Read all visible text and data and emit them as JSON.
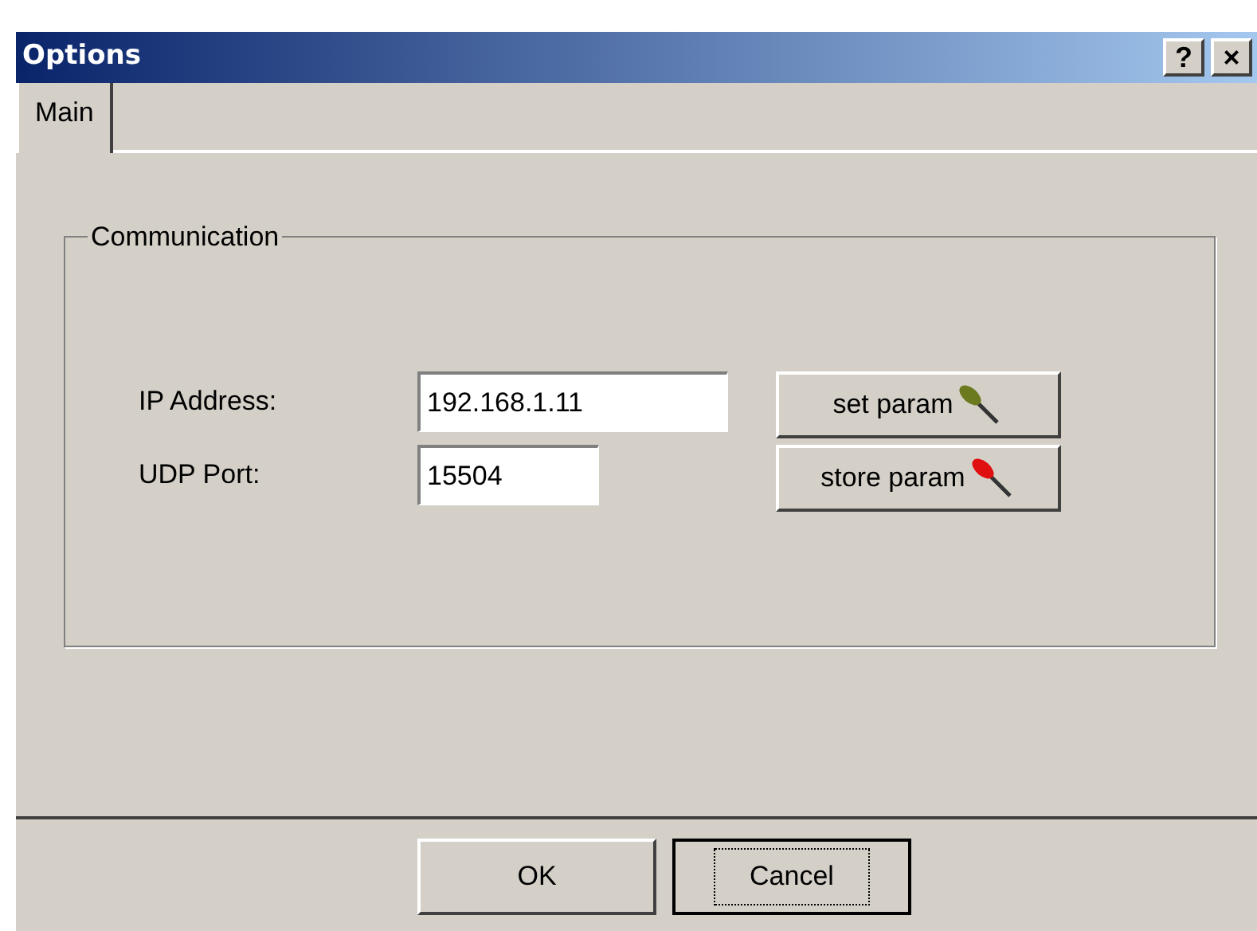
{
  "window": {
    "title": "Options",
    "title_buttons": [
      "?",
      "×"
    ]
  },
  "tabs": [
    {
      "label": "Main",
      "selected": true
    }
  ],
  "group": {
    "title": "Communication",
    "fields": [
      {
        "label": "IP Address:",
        "value": "192.168.1.11",
        "wide": true
      },
      {
        "label": "UDP Port:",
        "value": "15504",
        "wide": false
      }
    ],
    "buttons": [
      {
        "label": "set param",
        "color": "#6b7a1e"
      },
      {
        "label": "store param",
        "color": "#e01010"
      }
    ]
  },
  "footer_buttons": [
    {
      "label": "OK",
      "focused": false
    },
    {
      "label": "Cancel",
      "focused": true
    }
  ]
}
